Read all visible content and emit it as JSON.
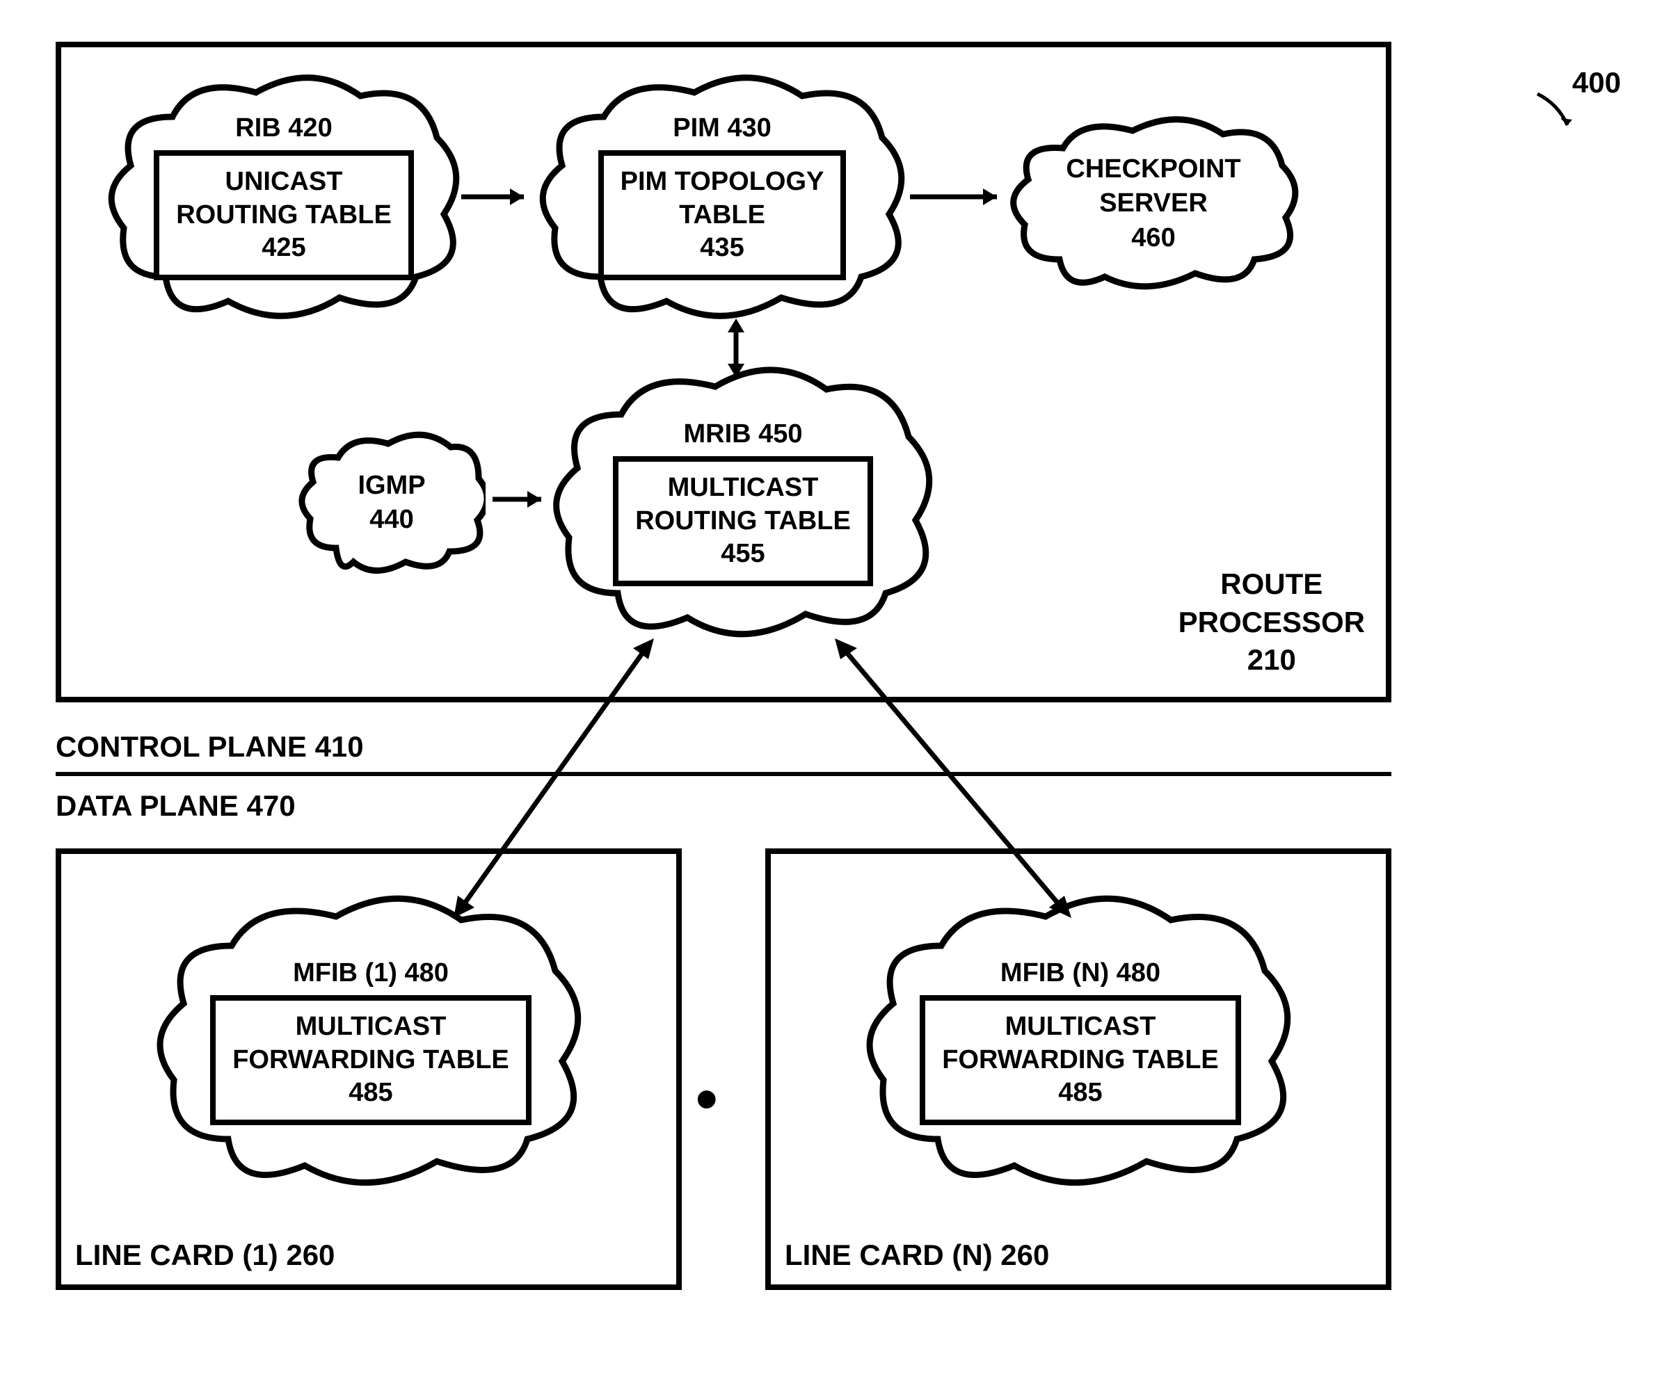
{
  "ref_number": "400",
  "route_processor": {
    "label_line1": "ROUTE",
    "label_line2": "PROCESSOR",
    "number": "210"
  },
  "control_plane": "CONTROL PLANE  410",
  "data_plane": "DATA PLANE  470",
  "rib": {
    "title": "RIB 420",
    "table_line1": "UNICAST",
    "table_line2": "ROUTING TABLE",
    "table_num": "425"
  },
  "pim": {
    "title": "PIM 430",
    "table_line1": "PIM TOPOLOGY",
    "table_line2": "TABLE",
    "table_num": "435"
  },
  "checkpoint": {
    "line1": "CHECKPOINT",
    "line2": "SERVER",
    "num": "460"
  },
  "igmp": {
    "line1": "IGMP",
    "num": "440"
  },
  "mrib": {
    "title": "MRIB 450",
    "table_line1": "MULTICAST",
    "table_line2": "ROUTING TABLE",
    "table_num": "455"
  },
  "mfib1": {
    "title": "MFIB (1) 480",
    "table_line1": "MULTICAST",
    "table_line2": "FORWARDING TABLE",
    "table_num": "485"
  },
  "mfibN": {
    "title": "MFIB (N) 480",
    "table_line1": "MULTICAST",
    "table_line2": "FORWARDING TABLE",
    "table_num": "485"
  },
  "line_card_1": "LINE CARD (1)  260",
  "line_card_N": "LINE CARD (N)  260",
  "dots": "• • •"
}
